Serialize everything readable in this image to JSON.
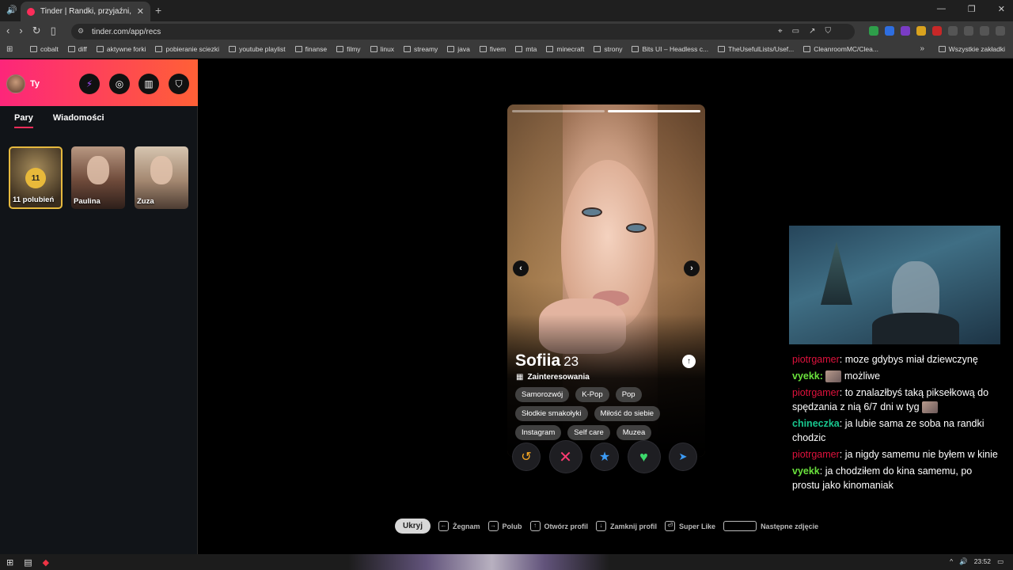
{
  "browser": {
    "tab_title": "Tinder | Randki, przyjaźni, nowe z",
    "url": "tinder.com/app/recs",
    "bookmarks": [
      "cobalt",
      "diff",
      "aktywne forki",
      "pobieranie sciezki",
      "youtube playlist",
      "finanse",
      "filmy",
      "linux",
      "streamy",
      "java",
      "fivem",
      "mta",
      "minecraft",
      "strony",
      "Bits UI – Headless c...",
      "TheUsefulLists/Usef...",
      "CleanroomMC/Clea..."
    ],
    "all_bookmarks": "Wszystkie zakładki"
  },
  "sidebar": {
    "me": "Ty",
    "tabs": [
      "Pary",
      "Wiadomości"
    ],
    "likes_count": "11",
    "likes_label": "11 polubień",
    "matches": [
      "Paulina",
      "Zuza"
    ]
  },
  "profile": {
    "name": "Sofiia",
    "age": "23",
    "interests_label": "Zainteresowania",
    "interests": [
      "Samorozwój",
      "K-Pop",
      "Pop",
      "Słodkie smakołyki",
      "Miłość do siebie",
      "Instagram",
      "Self care",
      "Muzea"
    ]
  },
  "hints": {
    "hide": "Ukryj",
    "nope": "Żegnam",
    "like": "Polub",
    "open": "Otwórz profil",
    "close": "Zamknij profil",
    "superlike": "Super Like",
    "next_photo": "Następne zdjęcie"
  },
  "chat": [
    {
      "user": "piotrgamer",
      "color": "red",
      "text": ": moze gdybys miał dziewczynę"
    },
    {
      "user": "vyekk",
      "color": "green",
      "text": "możliwe",
      "emote": true
    },
    {
      "user": "piotrgamer",
      "color": "red",
      "text": ": to znalazłbyś taką piksełkową do spędzania z nią 6/7 dni w tyg",
      "emote_end": true
    },
    {
      "user": "chineczka",
      "color": "teal",
      "text": ": ja lubie sama ze soba na randki chodzic"
    },
    {
      "user": "piotrgamer",
      "color": "red",
      "text": ": ja nigdy samemu nie byłem w kinie"
    },
    {
      "user": "vyekk",
      "color": "green",
      "text": ": ja chodziłem do kina samemu, po prostu jako kinomaniak"
    }
  ],
  "taskbar": {
    "time": "23:52"
  },
  "colors": {
    "brand_gradient_start": "#fd267a",
    "brand_gradient_end": "#ff6036",
    "like_green": "#3cd86b",
    "nope_pink": "#fe3c72",
    "gold": "#e8b93a"
  }
}
